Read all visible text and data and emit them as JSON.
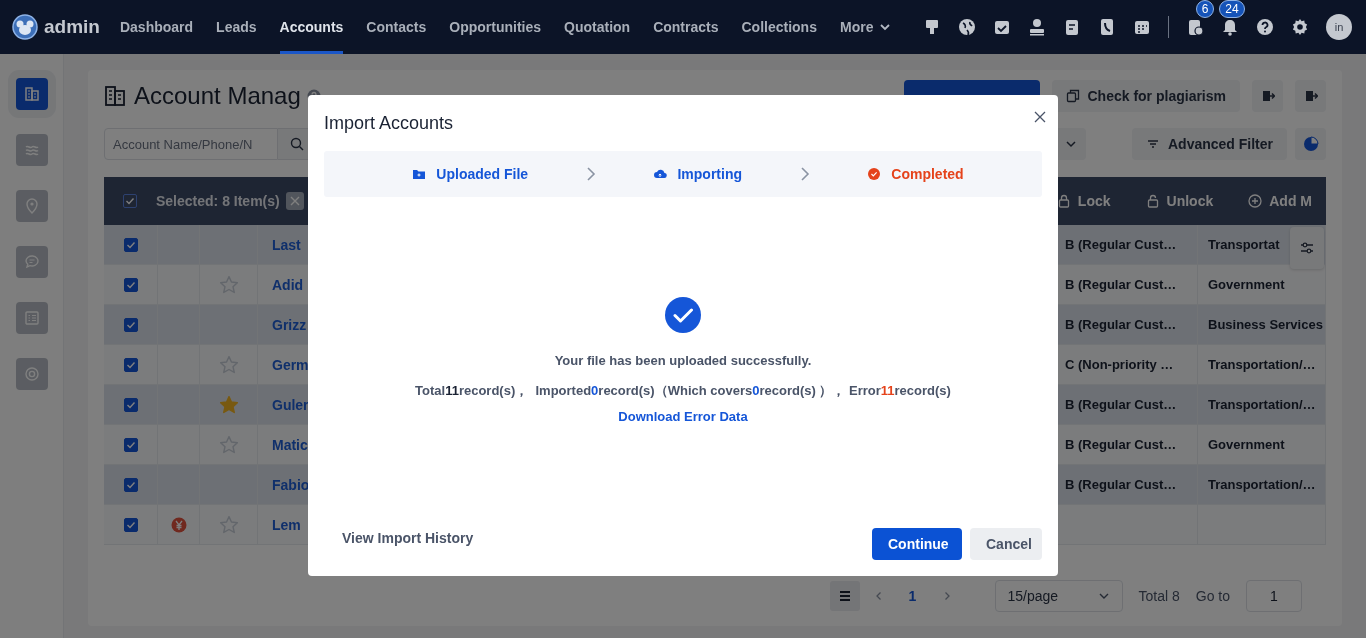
{
  "nav": {
    "brand": "admin",
    "items": [
      {
        "label": "Dashboard",
        "selected": false
      },
      {
        "label": "Leads",
        "selected": false
      },
      {
        "label": "Accounts",
        "selected": true
      },
      {
        "label": "Contacts",
        "selected": false
      },
      {
        "label": "Opportunities",
        "selected": false
      },
      {
        "label": "Quotation",
        "selected": false
      },
      {
        "label": "Contracts",
        "selected": false
      },
      {
        "label": "Collections",
        "selected": false
      }
    ],
    "more": "More",
    "task_badge": "6",
    "alert_badge": "24",
    "avatar": "in"
  },
  "sidebar": {
    "items": [
      {
        "selected": true
      },
      {
        "selected": false
      },
      {
        "selected": false
      },
      {
        "selected": false
      },
      {
        "selected": false
      },
      {
        "selected": false
      }
    ]
  },
  "page": {
    "title": "Account Manag",
    "plagiarism_button": "Check for plagiarism",
    "search_placeholder": "Account Name/Phone/N",
    "advanced_filter": "Advanced Filter"
  },
  "table": {
    "all_checked": true,
    "selection": "Selected: 8 Item(s)",
    "actions": [
      "Lock",
      "Unlock",
      "Add M"
    ],
    "rows": [
      {
        "checked": true,
        "currency_mark": false,
        "name": "Last",
        "grade": "B (Regular Cust…",
        "industry": "Transportat"
      },
      {
        "checked": true,
        "starred": false,
        "currency_mark": false,
        "name": "Adid",
        "grade": "B (Regular Cust…",
        "industry": "Government"
      },
      {
        "checked": true,
        "currency_mark": false,
        "name": "Grizz",
        "grade": "B (Regular Cust…",
        "industry": "Business Services"
      },
      {
        "checked": true,
        "starred": false,
        "currency_mark": false,
        "name": "Germ",
        "grade": "C (Non-priority …",
        "industry": "Transportation/…"
      },
      {
        "checked": true,
        "starred": true,
        "currency_mark": false,
        "name": "Guler",
        "grade": "B (Regular Cust…",
        "industry": "Transportation/…"
      },
      {
        "checked": true,
        "starred": false,
        "currency_mark": false,
        "name": "Matic",
        "grade": "B (Regular Cust…",
        "industry": "Government"
      },
      {
        "checked": true,
        "currency_mark": false,
        "name": "Fabio",
        "grade": "B (Regular Cust…",
        "industry": "Transportation/…"
      },
      {
        "checked": true,
        "starred": false,
        "currency_mark": true,
        "name": "Lem"
      }
    ]
  },
  "pagination": {
    "current_page": "1",
    "page_size": "15/page",
    "total": "Total 8",
    "goto_label": "Go to",
    "goto_value": "1"
  },
  "dialog": {
    "title": "Import Accounts",
    "steps": [
      {
        "label": "Uploaded File",
        "failed": false
      },
      {
        "label": "Importing",
        "failed": false
      },
      {
        "label": "Completed",
        "failed": true
      }
    ],
    "message": "Your file has been uploaded successfully.",
    "summary": [
      {
        "text": "Total",
        "kind": "label"
      },
      {
        "text": "11",
        "kind": "total"
      },
      {
        "text": "record(s)，  Imported",
        "kind": "label"
      },
      {
        "text": "0",
        "kind": "success"
      },
      {
        "text": "record(s)（Which covers",
        "kind": "label"
      },
      {
        "text": "0",
        "kind": "success"
      },
      {
        "text": "record(s) ）， Error",
        "kind": "label"
      },
      {
        "text": "11",
        "kind": "error"
      },
      {
        "text": "record(s)",
        "kind": "label"
      }
    ],
    "download_link": "Download Error Data",
    "history_link": "View Import History",
    "continue_button": "Continue",
    "cancel_button": "Cancel"
  }
}
